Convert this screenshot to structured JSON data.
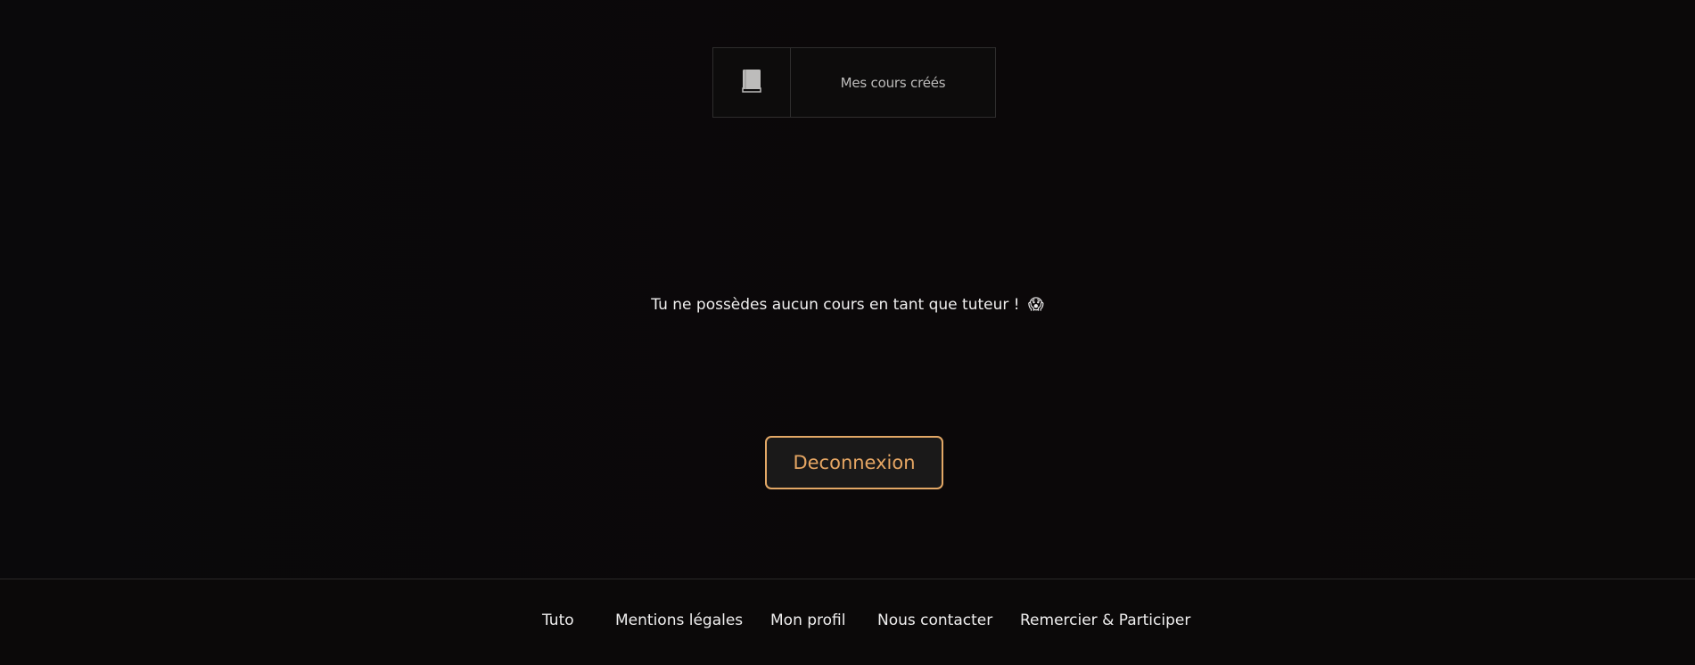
{
  "tabs": [
    {
      "icon": "book-icon",
      "label": "Mes cours créés"
    }
  ],
  "main": {
    "empty_message": "Tu ne possèdes aucun cours en tant que tuteur !",
    "empty_emoji": "😱"
  },
  "actions": {
    "logout_label": "Deconnexion"
  },
  "footer": {
    "links": [
      "Tuto",
      "Mentions légales",
      "Mon profil",
      "Nous contacter",
      "Remercier & Participer"
    ]
  },
  "colors": {
    "background": "#0b090b",
    "accent": "#e3a866",
    "text": "#efeeee",
    "border": "#2e2d2d"
  }
}
